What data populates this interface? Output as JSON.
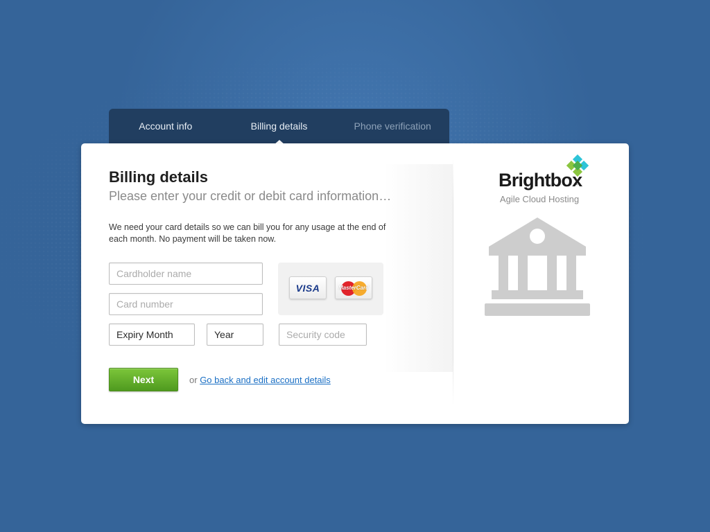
{
  "steps": [
    {
      "label": "Account info",
      "state": "done"
    },
    {
      "label": "Billing details",
      "state": "active"
    },
    {
      "label": "Phone verification",
      "state": "inactive"
    }
  ],
  "form": {
    "title": "Billing details",
    "subtitle": "Please enter your credit or debit card information…",
    "description": "We need your card details so we can bill you for any usage at the end of each month. No payment will be taken now.",
    "cardholder_placeholder": "Cardholder name",
    "card_number_placeholder": "Card number",
    "expiry_month_value": "Expiry Month",
    "year_value": "Year",
    "security_code_placeholder": "Security code",
    "next_label": "Next",
    "or_text": "or",
    "back_link": "Go back and edit account details"
  },
  "accepted_cards": [
    {
      "name": "VISA",
      "icon": "visa-logo-icon"
    },
    {
      "name": "MasterCard",
      "icon": "mastercard-logo-icon"
    }
  ],
  "brand": {
    "name": "Brightbox",
    "trademark": "™",
    "tagline": "Agile Cloud Hosting",
    "side_icon": "bank-icon"
  },
  "colors": {
    "background": "#356499",
    "stepper": "#213e60",
    "next_button": "#5ea82a",
    "link": "#1a6fc4",
    "logo_green": "#8bc53f",
    "logo_cyan": "#2ec4d8"
  }
}
